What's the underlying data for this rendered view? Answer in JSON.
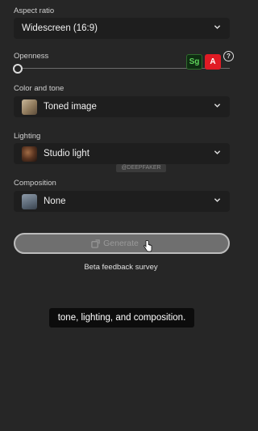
{
  "aspect_ratio": {
    "label": "Aspect ratio",
    "value": "Widescreen (16:9)"
  },
  "openness": {
    "label": "Openness",
    "level": 0
  },
  "color_tone": {
    "label": "Color and tone",
    "value": "Toned image"
  },
  "lighting": {
    "label": "Lighting",
    "value": "Studio light"
  },
  "composition": {
    "label": "Composition",
    "value": "None"
  },
  "generate": {
    "label": "Generate"
  },
  "beta_link": "Beta feedback survey",
  "caption": "tone, lighting, and composition.",
  "badges": {
    "sg": "Sg",
    "adobe": "A",
    "help": "?"
  },
  "watermark": "@DEEPFAKER",
  "colors": {
    "sg_bg": "#0f2d12",
    "sg_text": "#5fd35b",
    "adobe_bg": "#e01b24",
    "panel_bg": "#262626"
  }
}
